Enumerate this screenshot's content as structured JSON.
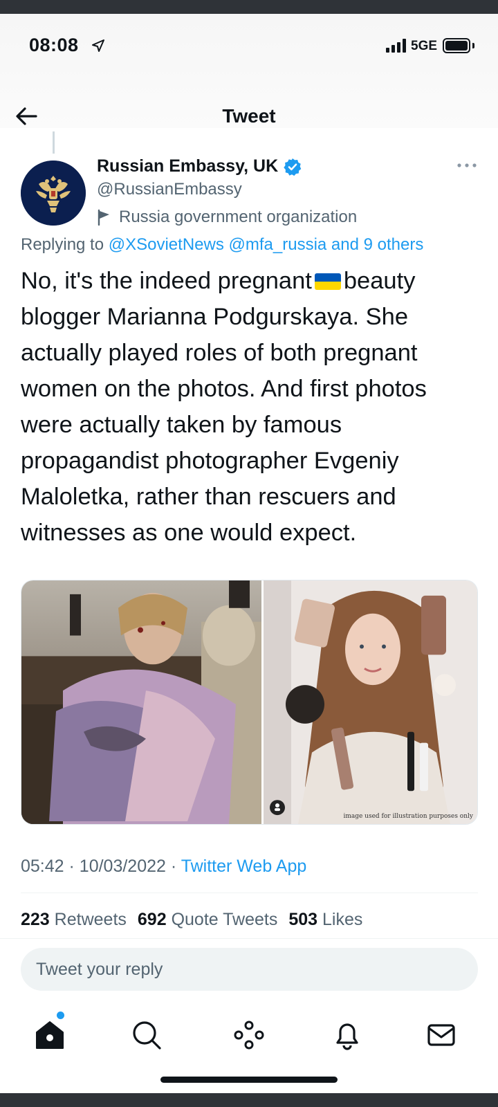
{
  "status_bar": {
    "time": "08:08",
    "network": "5GE",
    "icons": [
      "location-arrow-icon",
      "signal-icon",
      "battery-icon"
    ]
  },
  "header": {
    "title": "Tweet",
    "back_icon": "arrow-left-icon"
  },
  "tweet": {
    "display_name": "Russian Embassy, UK",
    "handle": "@RussianEmbassy",
    "label": "Russia government organization",
    "replying_prefix": "Replying to",
    "replying_mentions": "@XSovietNews @mfa_russia and 9 others",
    "text_part1": "No, it's the indeed pregnant",
    "text_part2": "beauty blogger Marianna Podgurskaya. She actually played roles of both pregnant women on the photos. And first photos were actually taken by famous propagandist photographer Evgeniy Maloletka, rather than rescuers and witnesses as one would expect.",
    "inline_emoji": "ukraine-flag",
    "media_caption": "image used for illustration purposes only",
    "time": "05:42",
    "date": "10/03/2022",
    "separator": "·",
    "source": "Twitter Web App",
    "stats": {
      "retweets_count": "223",
      "retweets_label": "Retweets",
      "quotes_count": "692",
      "quotes_label": "Quote Tweets",
      "likes_count": "503",
      "likes_label": "Likes"
    }
  },
  "reply": {
    "placeholder": "Tweet your reply"
  },
  "tab_bar": {
    "items": [
      "home-icon",
      "search-icon",
      "spaces-icon",
      "bell-icon",
      "mail-icon"
    ]
  },
  "colors": {
    "accent": "#1d9bf0",
    "text": "#0f1419",
    "muted": "#536471",
    "avatar_bg": "#0b1f4f",
    "ua_blue": "#0057b7",
    "ua_yellow": "#ffd700"
  }
}
